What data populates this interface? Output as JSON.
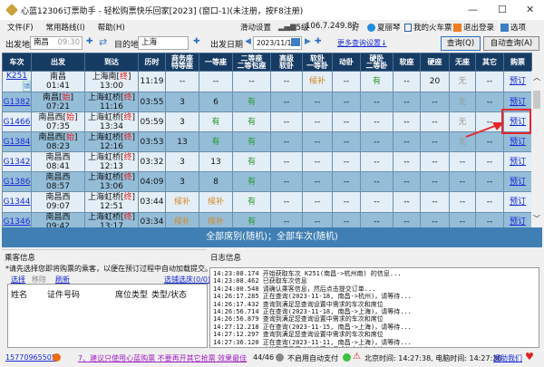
{
  "window": {
    "title": "心蓝12306订票助手 - 轻松购票快乐回家[2023] (窗口-1)(未注册，按F8注册)",
    "min": "—",
    "max": "☐",
    "close": "✕"
  },
  "menu": {
    "items": [
      "文件(F)",
      "常用路线(I)",
      "帮助(H)"
    ],
    "slide": "滑动设置",
    "signal": "5级",
    "ip": "106.7.249.87",
    "quality": "好",
    "user": "夏丽琴",
    "my_tickets": "我的火车票",
    "logout": "退出登录",
    "options": "选项"
  },
  "search": {
    "from_label": "出发地",
    "from_value": "南昌",
    "from_time": "09:30",
    "to_label": "目的地",
    "to_value": "上海",
    "date_label": "出发日期",
    "date_value": "2023/11/11",
    "more": "更多查询设置↓",
    "query": "查询(Q)",
    "auto_query": "自动查询(A)"
  },
  "table": {
    "headers": [
      "车次",
      "出发",
      "到达",
      "历时",
      "商务座\n特等座",
      "一等座",
      "二等座\n二等包座",
      "高级\n软卧",
      "软卧\n一等卧",
      "动卧",
      "硬卧\n二等卧",
      "软座",
      "硬座",
      "无座",
      "其它",
      "购票"
    ],
    "rows": [
      {
        "train": "K251",
        "tag": "铺",
        "from": "南昌",
        "from_mark": "",
        "dep": "01:41",
        "to": "上海南",
        "to_mark": "终",
        "arr": "13:00",
        "dur": "11:19",
        "seats": [
          "--",
          "--",
          "--",
          "--",
          "候补",
          "--",
          "有",
          "--",
          "20",
          "无",
          "--"
        ],
        "book": "预订"
      },
      {
        "train": "G1382",
        "tag": "",
        "from": "南昌",
        "from_mark": "始",
        "dep": "07:21",
        "to": "上海虹桥",
        "to_mark": "终",
        "arr": "11:16",
        "dur": "03:55",
        "seats": [
          "3",
          "6",
          "有",
          "--",
          "--",
          "--",
          "--",
          "--",
          "--",
          "无",
          "--"
        ],
        "book": "预订"
      },
      {
        "train": "G1466",
        "tag": "",
        "from": "南昌西",
        "from_mark": "始",
        "dep": "07:35",
        "to": "上海虹桥",
        "to_mark": "终",
        "arr": "13:34",
        "dur": "05:59",
        "seats": [
          "3",
          "有",
          "有",
          "--",
          "--",
          "--",
          "--",
          "--",
          "--",
          "无",
          "--"
        ],
        "book": "预订"
      },
      {
        "train": "G1384",
        "tag": "",
        "from": "南昌西",
        "from_mark": "始",
        "dep": "08:23",
        "to": "上海虹桥",
        "to_mark": "终",
        "arr": "12:16",
        "dur": "03:53",
        "seats": [
          "13",
          "有",
          "有",
          "--",
          "--",
          "--",
          "--",
          "--",
          "--",
          "无",
          "--"
        ],
        "book": "预订"
      },
      {
        "train": "G1342",
        "tag": "",
        "from": "南昌西",
        "from_mark": "",
        "dep": "08:41",
        "to": "上海虹桥",
        "to_mark": "终",
        "arr": "12:13",
        "dur": "03:32",
        "seats": [
          "3",
          "13",
          "有",
          "--",
          "--",
          "--",
          "--",
          "--",
          "--",
          "--",
          "--"
        ],
        "book": "预订"
      },
      {
        "train": "G1386",
        "tag": "",
        "from": "南昌西",
        "from_mark": "",
        "dep": "08:57",
        "to": "上海虹桥",
        "to_mark": "终",
        "arr": "13:06",
        "dur": "04:09",
        "seats": [
          "3",
          "8",
          "有",
          "--",
          "--",
          "--",
          "--",
          "--",
          "--",
          "--",
          "--"
        ],
        "book": "预订"
      },
      {
        "train": "G1344",
        "tag": "",
        "from": "南昌西",
        "from_mark": "",
        "dep": "09:07",
        "to": "上海虹桥",
        "to_mark": "终",
        "arr": "12:51",
        "dur": "03:44",
        "seats": [
          "候补",
          "候补",
          "有",
          "--",
          "--",
          "--",
          "--",
          "--",
          "--",
          "--",
          "--"
        ],
        "book": "预订"
      },
      {
        "train": "G1346",
        "tag": "",
        "from": "南昌西",
        "from_mark": "",
        "dep": "09:42",
        "to": "上海虹桥",
        "to_mark": "终",
        "arr": "13:17",
        "dur": "03:34",
        "seats": [
          "候补",
          "候补",
          "有",
          "--",
          "--",
          "--",
          "--",
          "--",
          "--",
          "--",
          "--"
        ],
        "book": "预订"
      }
    ]
  },
  "bluebar": "全部席别(随机)；全部车次(随机)",
  "passenger": {
    "title": "乘客信息",
    "hint": "*请先选择您即将购票的乘客，以便在预订过程中自动加载提交。",
    "select": "选择",
    "remove": "移除",
    "refresh": "刷新",
    "berth": "选铺选床(0/0)",
    "columns": [
      "姓名",
      "证件号码",
      "席位类型",
      "类型/状态"
    ]
  },
  "log": {
    "title": "日志信息",
    "lines": [
      "14:23:08.174 开始获取车次 K251(南昌->杭州南) 的信息...",
      "14:23:08.462 已获取车次信息",
      "14:24:00.548 请确认乘客信息，然后点击提交订单...",
      "14:26:17.285 正在查询(2023-11-18, 南昌->杭州)，请等待...",
      "14:26:17.432 查询到满足您查询设置中需求的车次和席位",
      "14:26:56.714 正在查询(2023-11-18, 南昌->上海)，请等待...",
      "14:26:56.879 查询到满足您查询设置中需求的车次和席位",
      "14:27:12.218 正在查询(2023-11-15, 南昌->上海)，请等待...",
      "14:27:12.297 查询到满足您查询设置中需求的车次和席位",
      "14:27:36.120 正在查询(2023-11-11, 南昌->上海)，请等待...",
      "14:27:36.254 查询到满足您查询设置中需求的车次和席位"
    ]
  },
  "status": {
    "phone": "15770965505",
    "tip": "7、建议只使用心蓝购票 不要再开其它抢票 效果最佳",
    "count": "44/46",
    "autopay": "不启用自动支付",
    "time": "北京时间: 14:27:38, 电脑时间: 14:27:38",
    "help": "援助我们"
  }
}
